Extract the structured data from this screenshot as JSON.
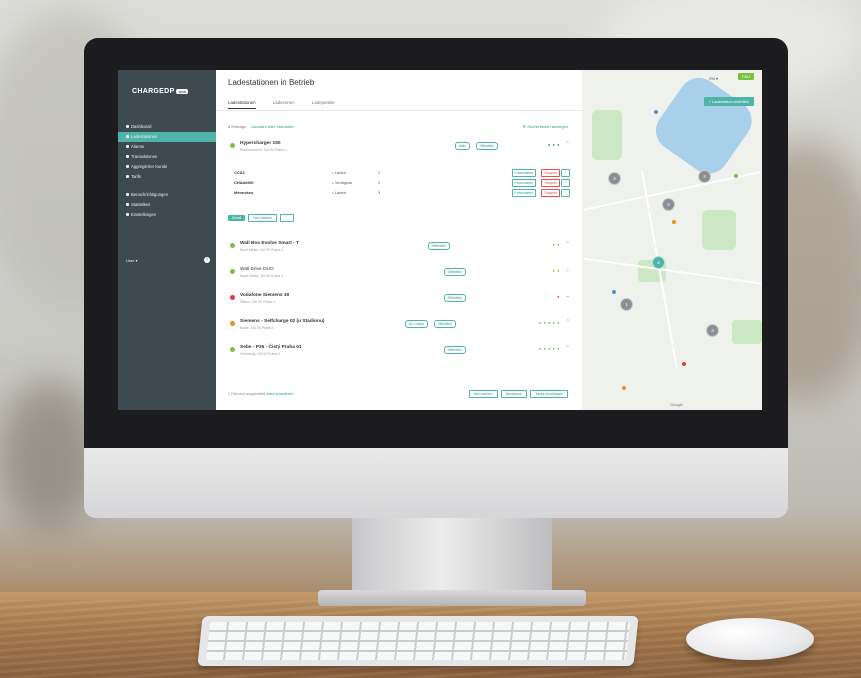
{
  "app": {
    "logo_text": "CHARGEDP",
    "logo_badge": "one",
    "page_title": "Ladestationen in Betrieb",
    "language": "EN ▾"
  },
  "sidebar": {
    "items": [
      {
        "label": "Dashboard",
        "active": false
      },
      {
        "label": "Ladestationen",
        "active": true
      },
      {
        "label": "Alarms",
        "active": false
      },
      {
        "label": "Transaktionen",
        "active": false
      },
      {
        "label": "Aggregierter Kunde",
        "active": false
      },
      {
        "label": "Tarifs",
        "active": false
      }
    ],
    "items2": [
      {
        "label": "Benachrichtigungen"
      },
      {
        "label": "Statistiken"
      },
      {
        "label": "Einstellungen"
      }
    ],
    "user": "User ▾",
    "help": "?"
  },
  "tabs": [
    {
      "label": "Ladestationen",
      "active": true
    },
    {
      "label": "Ladezonen",
      "active": false
    },
    {
      "label": "Ladepunkte",
      "active": false
    }
  ],
  "selection": {
    "count_text": "8 Einträge",
    "select_all": "Auswahl aller Standorte",
    "filter": "Suchkriterien anzeigen"
  },
  "expanded_station": {
    "name": "Hypercharger 150",
    "address": "Pracherova 24, 110 00 Praha 1",
    "pills": [
      "Aktiv",
      "Offentlich"
    ],
    "connectors": [
      {
        "name": "CCS2",
        "status": "Laden",
        "count": "1"
      },
      {
        "name": "CHAdeMO",
        "status": "Verfügbar",
        "count": "2"
      },
      {
        "name": "Mennekes",
        "status": "Laden",
        "count": "3"
      }
    ],
    "connector_buttons": {
      "unlock": "Freischalten",
      "stop": "Stoppen",
      "more": "⋮"
    }
  },
  "action_buttons": {
    "detail": "Detail",
    "new_station": "Neu starten",
    "more": "⋮"
  },
  "stations": [
    {
      "name": "Wall Box Evolve Smart - T",
      "address": "Nové Město, 110 00 Praha 1",
      "color": "#7ac142",
      "pills": [
        "Öffentlich"
      ],
      "stars": "● ●"
    },
    {
      "name": "Wall Drive DUO",
      "address": "Staré Město, 110 00 Praha 1",
      "color": "#7ac142",
      "pills": [
        "Öffentlich"
      ],
      "stars": "● ●"
    },
    {
      "name": "Vodafone Siemens 19",
      "address": "Žižkov, 130 00 Praha 3",
      "color": "#e03b3b",
      "pills": [
        "Öffentlich"
      ],
      "stars": "●"
    },
    {
      "name": "Siemens - Selfcharge 02 (u Stadionu)",
      "address": "Nusle, 140 00 Praha 4",
      "color": "#f08c1a",
      "pills": [
        "AC Laden",
        "Öffentlich"
      ],
      "stars": "● ● ● ● ●"
    },
    {
      "name": "Sebe - P36 - Čistý Praha 01",
      "address": "Vinohrady, 120 00 Praha 2",
      "color": "#7ac142",
      "pills": [
        "Öffentlich"
      ],
      "stars": "● ● ● ● ●"
    }
  ],
  "footer": {
    "text": "1 Element ausgewählt",
    "link": "Alles auswählen",
    "buttons": [
      "Neu starten",
      "Neubauen",
      "Tasks hinzufügen"
    ]
  },
  "map": {
    "create_button": "+ Ladestation erstellen",
    "top_button": "FAU",
    "clusters": [
      "3",
      "3",
      "2",
      "4",
      "1",
      "3"
    ],
    "google": "Google"
  }
}
